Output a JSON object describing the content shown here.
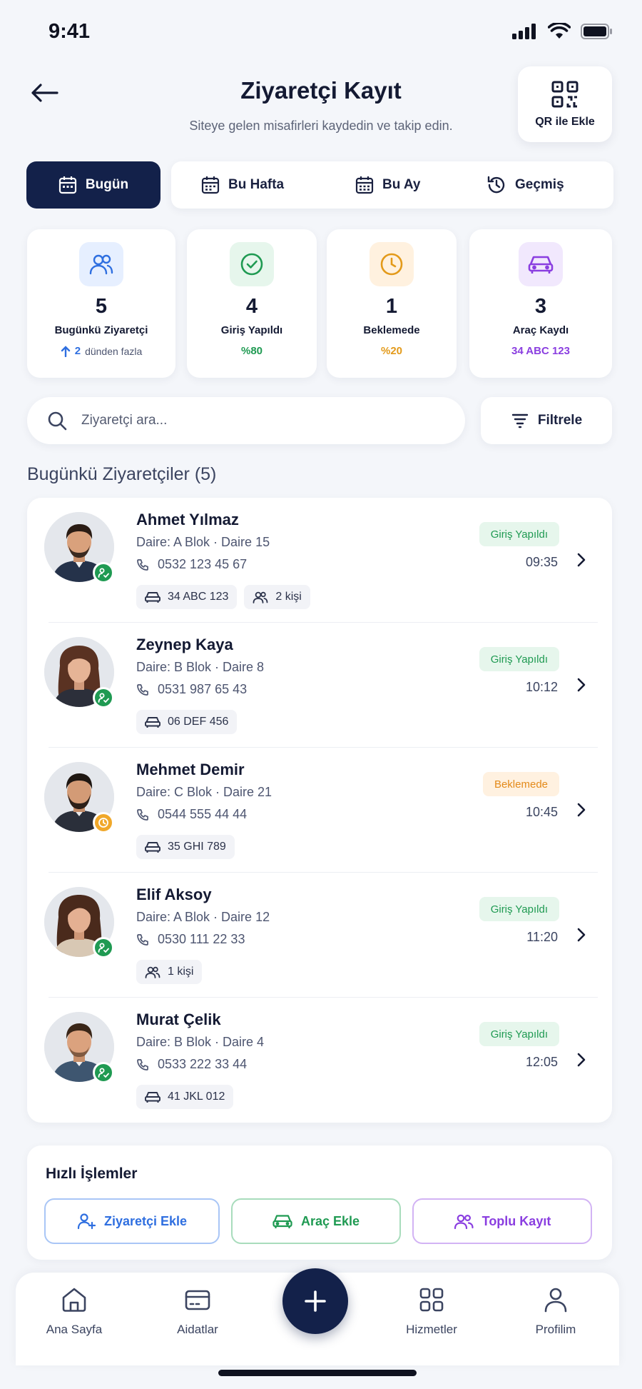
{
  "status_bar": {
    "time": "9:41"
  },
  "header": {
    "title": "Ziyaretçi Kayıt",
    "subtitle": "Siteye gelen misafirleri kaydedin ve takip edin.",
    "qr_button": "QR ile Ekle"
  },
  "tabs": [
    {
      "label": "Bugün",
      "icon": "calendar-icon",
      "active": true
    },
    {
      "label": "Bu Hafta",
      "icon": "calendar-week-icon",
      "active": false
    },
    {
      "label": "Bu Ay",
      "icon": "calendar-month-icon",
      "active": false
    },
    {
      "label": "Geçmiş",
      "icon": "history-icon",
      "active": false
    }
  ],
  "stats": [
    {
      "value": "5",
      "label": "Bugünkü Ziyaretçi",
      "sub_value": "2",
      "sub_text": "dünden fazla",
      "icon": "users-icon",
      "color": "#2f6fe0",
      "bg": "#e6efff"
    },
    {
      "value": "4",
      "label": "Giriş Yapıldı",
      "sub": "%80",
      "icon": "check-circle-icon",
      "color": "#1f9a52",
      "bg": "#e6f6ec"
    },
    {
      "value": "1",
      "label": "Beklemede",
      "sub": "%20",
      "icon": "clock-icon",
      "color": "#e39a1a",
      "bg": "#fff1df"
    },
    {
      "value": "3",
      "label": "Araç Kaydı",
      "sub": "34 ABC 123",
      "icon": "car-icon",
      "color": "#8a3ee0",
      "bg": "#f1e8fd"
    }
  ],
  "search": {
    "placeholder": "Ziyaretçi ara...",
    "filter_label": "Filtrele"
  },
  "section_title": "Bugünkü Ziyaretçiler (5)",
  "visitors": [
    {
      "name": "Ahmet Yılmaz",
      "unit": "Daire: A Blok · Daire 15",
      "phone": "0532 123 45 67",
      "plate": "34 ABC 123",
      "people": "2 kişi",
      "status": "Giriş Yapıldı",
      "status_type": "green",
      "time": "09:35"
    },
    {
      "name": "Zeynep Kaya",
      "unit": "Daire: B Blok · Daire 8",
      "phone": "0531 987 65 43",
      "plate": "06 DEF 456",
      "people": "",
      "status": "Giriş Yapıldı",
      "status_type": "green",
      "time": "10:12"
    },
    {
      "name": "Mehmet Demir",
      "unit": "Daire: C Blok · Daire 21",
      "phone": "0544 555 44 44",
      "plate": "35 GHI 789",
      "people": "",
      "status": "Beklemede",
      "status_type": "orange",
      "time": "10:45"
    },
    {
      "name": "Elif Aksoy",
      "unit": "Daire: A Blok · Daire 12",
      "phone": "0530 111 22 33",
      "plate": "",
      "people": "1 kişi",
      "status": "Giriş Yapıldı",
      "status_type": "green",
      "time": "11:20"
    },
    {
      "name": "Murat Çelik",
      "unit": "Daire: B Blok · Daire 4",
      "phone": "0533 222 33 44",
      "plate": "41 JKL 012",
      "people": "",
      "status": "Giriş Yapıldı",
      "status_type": "green",
      "time": "12:05"
    }
  ],
  "quick_actions": {
    "title": "Hızlı İşlemler",
    "items": [
      {
        "label": "Ziyaretçi Ekle",
        "icon": "user-plus-icon",
        "color": "#2f6fe0",
        "border": "#a9c6f6"
      },
      {
        "label": "Araç Ekle",
        "icon": "car-icon",
        "color": "#1f9a52",
        "border": "#a8dcbc"
      },
      {
        "label": "Toplu Kayıt",
        "icon": "users-icon",
        "color": "#8a3ee0",
        "border": "#d2b3f4"
      }
    ]
  },
  "bottom_nav": [
    {
      "label": "Ana Sayfa",
      "icon": "home-icon"
    },
    {
      "label": "Aidatlar",
      "icon": "card-icon"
    },
    {
      "label": "Hizmetler",
      "icon": "grid-icon"
    },
    {
      "label": "Profilim",
      "icon": "user-icon"
    }
  ],
  "colors": {
    "primary": "#13214a",
    "green": "#1f9a52",
    "orange": "#e38a1a",
    "purple": "#8a3ee0",
    "blue": "#2f6fe0"
  }
}
